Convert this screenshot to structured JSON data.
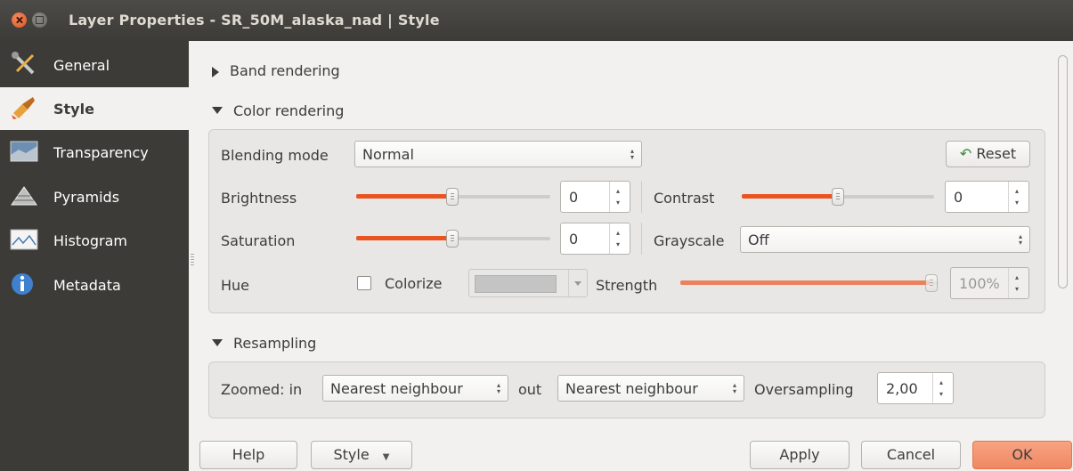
{
  "window": {
    "title": "Layer Properties - SR_50M_alaska_nad | Style"
  },
  "sidebar": {
    "items": [
      {
        "label": "General",
        "icon": "tools-icon",
        "active": false
      },
      {
        "label": "Style",
        "icon": "paintbrush-icon",
        "active": true
      },
      {
        "label": "Transparency",
        "icon": "transparency-icon",
        "active": false
      },
      {
        "label": "Pyramids",
        "icon": "pyramids-icon",
        "active": false
      },
      {
        "label": "Histogram",
        "icon": "histogram-icon",
        "active": false
      },
      {
        "label": "Metadata",
        "icon": "info-icon",
        "active": false
      }
    ]
  },
  "band_rendering": {
    "label": "Band rendering",
    "expanded": false
  },
  "color_rendering": {
    "label": "Color rendering",
    "expanded": true,
    "blending_mode": {
      "label": "Blending mode",
      "value": "Normal"
    },
    "reset_label": "Reset",
    "brightness": {
      "label": "Brightness",
      "value": "0",
      "slider_fraction": 0.5
    },
    "contrast": {
      "label": "Contrast",
      "value": "0",
      "slider_fraction": 0.5
    },
    "saturation": {
      "label": "Saturation",
      "value": "0",
      "slider_fraction": 0.5
    },
    "grayscale": {
      "label": "Grayscale",
      "value": "Off"
    },
    "hue": {
      "label": "Hue",
      "colorize_label": "Colorize",
      "colorize_checked": false,
      "color": "#c4c4c4"
    },
    "strength": {
      "label": "Strength",
      "value": "100%",
      "slider_fraction": 1.0
    }
  },
  "resampling": {
    "label": "Resampling",
    "expanded": true,
    "zoomed_in_label": "Zoomed: in",
    "zoomed_in_value": "Nearest neighbour",
    "out_label": "out",
    "zoomed_out_value": "Nearest neighbour",
    "oversampling_label": "Oversampling",
    "oversampling_value": "2,00"
  },
  "buttons": {
    "help": "Help",
    "style": "Style",
    "apply": "Apply",
    "cancel": "Cancel",
    "ok": "OK"
  },
  "colors": {
    "accent": "#e95420",
    "sidebar_bg": "#3c3b37",
    "titlebar_bg": "#3c3b37"
  }
}
